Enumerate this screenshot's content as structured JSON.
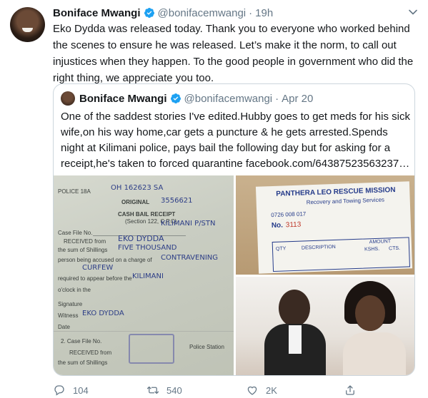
{
  "tweet": {
    "author_name": "Boniface Mwangi",
    "author_handle": "@bonifacemwangi",
    "separator": "·",
    "time": "19h",
    "text": "Eko Dydda was released today. Thank you to everyone who worked behind the scenes to ensure he was released.  Let’s make it the norm, to call out injustices when they happen. To the good people in government who did the right thing, we appreciate you too."
  },
  "quoted_tweet": {
    "author_name": "Boniface Mwangi",
    "author_handle": "@bonifacemwangi",
    "separator": "·",
    "time": "Apr 20",
    "text": "One of the saddest stories I've edited.Hubby goes to get meds for his sick wife,on his way home,car gets a puncture & he gets arrested.Spends night at Kilimani police, pays bail the following day but for asking for a receipt,he's taken to forced quarantine facebook.com/64387523563237…",
    "images": {
      "receipt": {
        "printed": [
          "POLICE 18A",
          "ORIGINAL",
          "CASH BAIL RECEIPT",
          "(Section 122, C.P.C)",
          "Case File No.",
          "RECEIVED from",
          "the sum of Shillings",
          "person being accused on a charge of",
          "required to appear before the",
          "o'clock in the",
          "Signature",
          "Witness",
          "Date",
          "2. Case File No.",
          "RECEIVED from",
          "the sum of Shillings",
          "Police Station"
        ],
        "handwritten": [
          "OH 162623 SA",
          "3556621",
          "KILIMANI P/STN",
          "EKO DYDDA",
          "FIVE THOUSAND",
          "CONTRAVENING",
          "CURFEW",
          "KILIMANI",
          "EKO DYDDA"
        ]
      },
      "mission_receipt": {
        "title": "PANTHERA LEO RESCUE MISSION",
        "subtitle": "Recovery and Towing Services",
        "number_label": "No.",
        "number": "3113",
        "phone": "0726 008 017",
        "table_headers": [
          "QTY",
          "DESCRIPTION",
          "AMOUNT",
          "KSHS.",
          "CTS."
        ]
      }
    }
  },
  "actions": {
    "reply_count": "104",
    "retweet_count": "540",
    "like_count": "2K",
    "share_count": ""
  },
  "colors": {
    "verified": "#1da1f2",
    "secondary_text": "#657786",
    "border": "#ccd6dd"
  },
  "icons": [
    "caret-down-icon",
    "verified-badge-icon",
    "reply-icon",
    "retweet-icon",
    "like-icon",
    "share-icon"
  ]
}
